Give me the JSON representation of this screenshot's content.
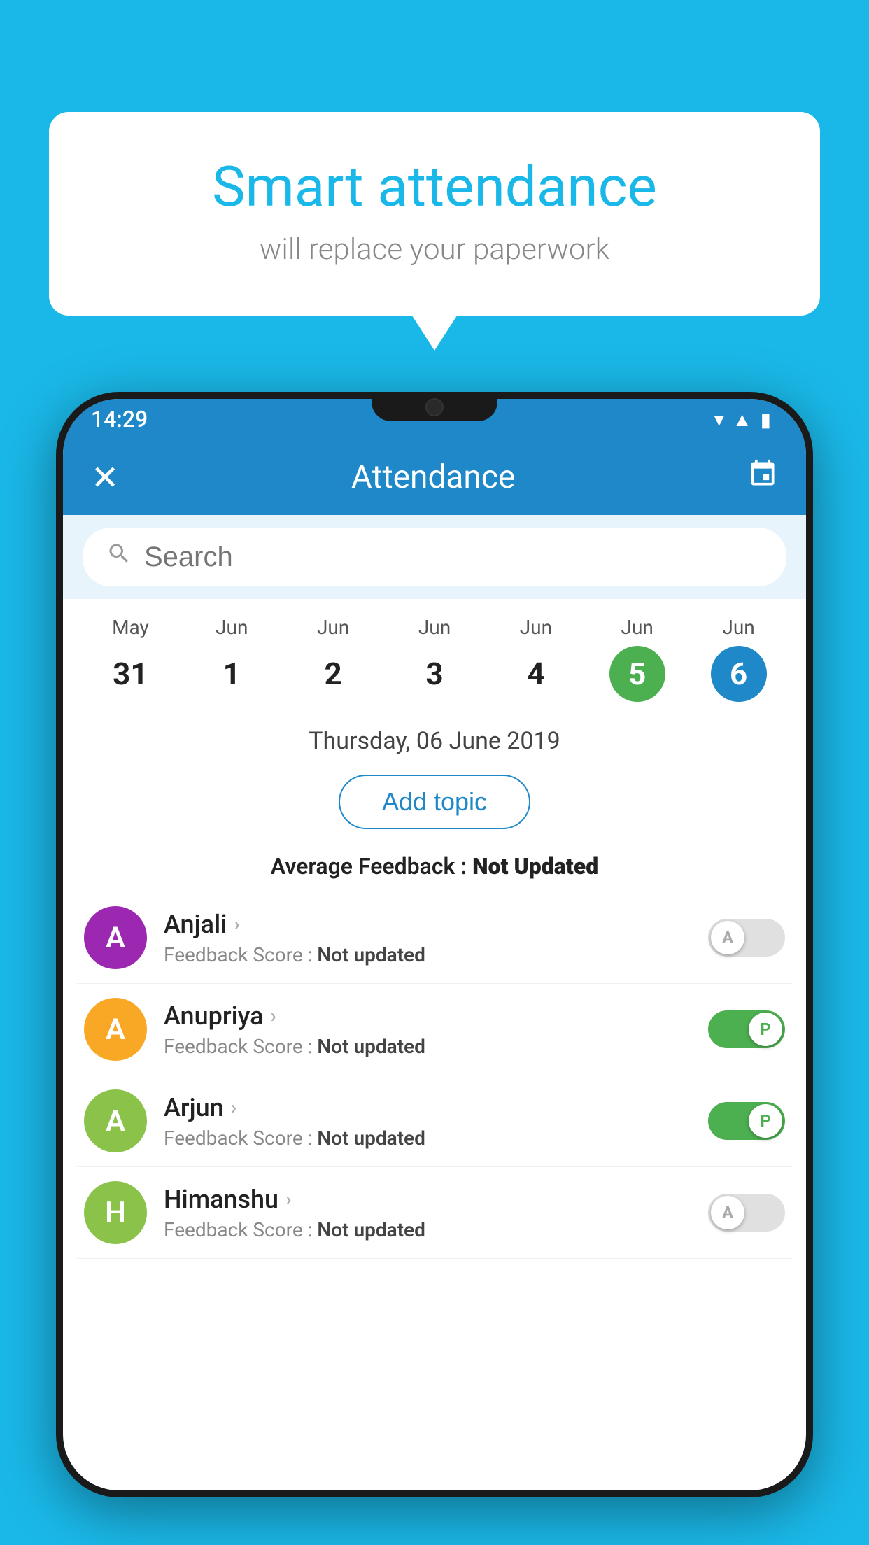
{
  "background_color": "#1ab8e8",
  "speech_bubble": {
    "title": "Smart attendance",
    "subtitle": "will replace your paperwork"
  },
  "status_bar": {
    "time": "14:29",
    "icons": [
      "wifi",
      "signal",
      "battery"
    ]
  },
  "app_header": {
    "close_label": "✕",
    "title": "Attendance",
    "calendar_icon": "📅"
  },
  "search": {
    "placeholder": "Search"
  },
  "calendar": {
    "days": [
      {
        "month": "May",
        "date": "31",
        "state": "normal"
      },
      {
        "month": "Jun",
        "date": "1",
        "state": "normal"
      },
      {
        "month": "Jun",
        "date": "2",
        "state": "normal"
      },
      {
        "month": "Jun",
        "date": "3",
        "state": "normal"
      },
      {
        "month": "Jun",
        "date": "4",
        "state": "normal"
      },
      {
        "month": "Jun",
        "date": "5",
        "state": "today"
      },
      {
        "month": "Jun",
        "date": "6",
        "state": "selected"
      }
    ]
  },
  "selected_date": "Thursday, 06 June 2019",
  "add_topic_label": "Add topic",
  "average_feedback": {
    "label": "Average Feedback : ",
    "value": "Not Updated"
  },
  "students": [
    {
      "name": "Anjali",
      "avatar_letter": "A",
      "avatar_color": "#9c27b0",
      "feedback": "Feedback Score : ",
      "feedback_value": "Not updated",
      "toggle_state": "off",
      "toggle_letter": "A"
    },
    {
      "name": "Anupriya",
      "avatar_letter": "A",
      "avatar_color": "#f9a825",
      "feedback": "Feedback Score : ",
      "feedback_value": "Not updated",
      "toggle_state": "on",
      "toggle_letter": "P"
    },
    {
      "name": "Arjun",
      "avatar_letter": "A",
      "avatar_color": "#8bc34a",
      "feedback": "Feedback Score : ",
      "feedback_value": "Not updated",
      "toggle_state": "on",
      "toggle_letter": "P"
    },
    {
      "name": "Himanshu",
      "avatar_letter": "H",
      "avatar_color": "#8bc34a",
      "feedback": "Feedback Score : ",
      "feedback_value": "Not updated",
      "toggle_state": "off",
      "toggle_letter": "A"
    }
  ]
}
